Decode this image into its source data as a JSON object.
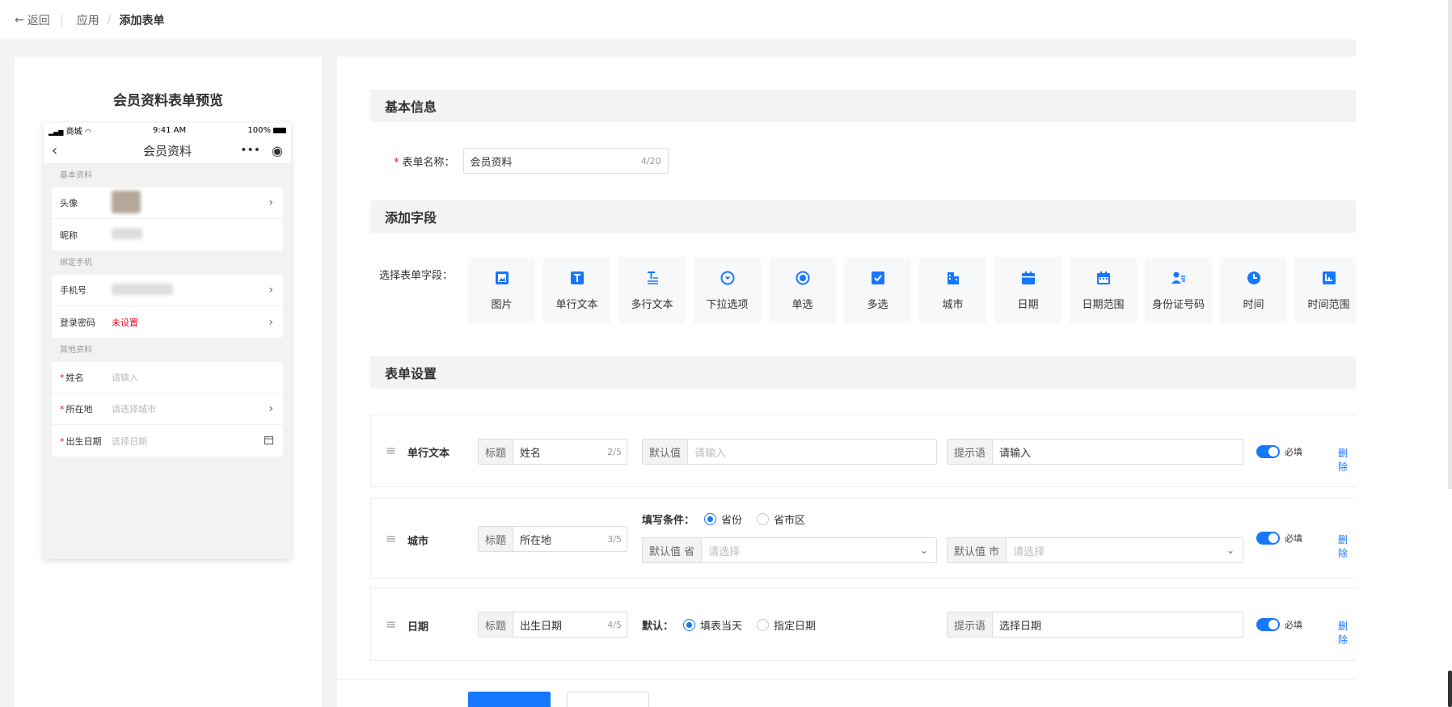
{
  "topbar": {
    "back_label": "返回",
    "crumb_app": "应用",
    "crumb_current": "添加表单"
  },
  "preview": {
    "title": "会员资料表单预览",
    "status": {
      "carrier": "商城",
      "time": "9:41 AM",
      "battery": "100%"
    },
    "nav_title": "会员资料",
    "sections": {
      "basic": "基本资料",
      "phone": "绑定手机",
      "other": "其他资料"
    },
    "rows": {
      "avatar": "头像",
      "nickname": "昵称",
      "mobile": "手机号",
      "password": "登录密码",
      "password_value": "未设置",
      "name": "姓名",
      "name_ph": "请输入",
      "location": "所在地",
      "location_ph": "请选择城市",
      "birthday": "出生日期",
      "birthday_ph": "选择日期"
    }
  },
  "main": {
    "basic_header": "基本信息",
    "form_name_label": "表单名称：",
    "form_name_value": "会员资料",
    "form_name_count": "4/20",
    "add_field_header": "添加字段",
    "field_picker_label": "选择表单字段：",
    "tiles": [
      {
        "name": "图片",
        "icon": "image-icon"
      },
      {
        "name": "单行文本",
        "icon": "text-icon"
      },
      {
        "name": "多行文本",
        "icon": "multiline-text-icon"
      },
      {
        "name": "下拉选项",
        "icon": "dropdown-icon"
      },
      {
        "name": "单选",
        "icon": "radio-icon"
      },
      {
        "name": "多选",
        "icon": "checkbox-icon"
      },
      {
        "name": "城市",
        "icon": "city-icon"
      },
      {
        "name": "日期",
        "icon": "calendar-icon"
      },
      {
        "name": "日期范围",
        "icon": "calendar-range-icon"
      },
      {
        "name": "身份证号码",
        "icon": "id-card-icon"
      },
      {
        "name": "时间",
        "icon": "clock-icon"
      },
      {
        "name": "时间范围",
        "icon": "time-range-icon"
      }
    ],
    "settings_header": "表单设置",
    "settings": {
      "text": {
        "name": "单行文本",
        "title_pre": "标题",
        "title_value": "姓名",
        "title_count": "2/5",
        "default_pre": "默认值",
        "default_ph": "请输入",
        "hint_pre": "提示语",
        "hint_value": "请输入",
        "required": "必填",
        "delete": "删除"
      },
      "city": {
        "name": "城市",
        "title_pre": "标题",
        "title_value": "所在地",
        "title_count": "3/5",
        "cond_label": "填写条件：",
        "opt_province": "省份",
        "opt_full": "省市区",
        "default_prov_pre": "默认值 省",
        "default_prov_ph": "请选择",
        "default_city_pre": "默认值 市",
        "default_city_ph": "请选择",
        "required": "必填",
        "delete": "删除"
      },
      "date": {
        "name": "日期",
        "title_pre": "标题",
        "title_value": "出生日期",
        "title_count": "4/5",
        "default_label": "默认：",
        "opt_today": "填表当天",
        "opt_pick": "指定日期",
        "hint_pre": "提示语",
        "hint_value": "选择日期",
        "required": "必填",
        "delete": "删除"
      }
    }
  },
  "colors": {
    "accent": "#1677ff",
    "required_star": "#ee0a24",
    "section_bg": "#f2f3f5"
  }
}
